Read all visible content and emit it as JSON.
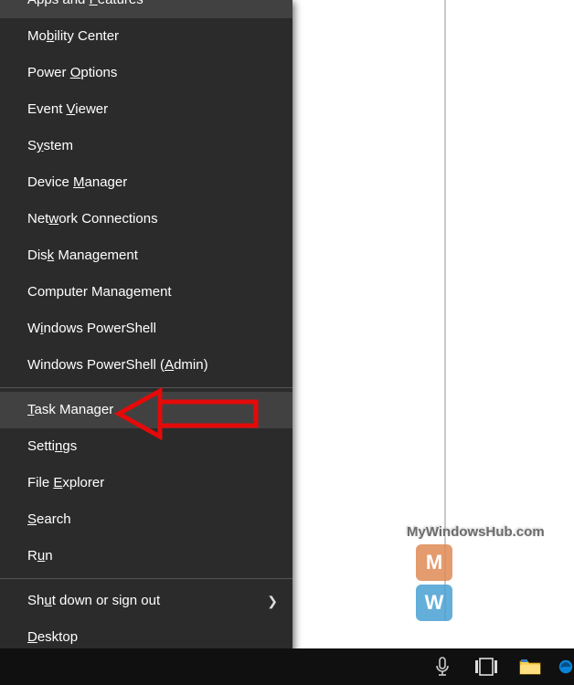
{
  "menu": {
    "items": [
      {
        "label": "Apps and Features",
        "accel_index": 9,
        "highlight": false
      },
      {
        "label": "Mobility Center",
        "accel_index": 2,
        "highlight": false
      },
      {
        "label": "Power Options",
        "accel_index": 6,
        "highlight": false
      },
      {
        "label": "Event Viewer",
        "accel_index": 6,
        "highlight": false
      },
      {
        "label": "System",
        "accel_index": 1,
        "highlight": false
      },
      {
        "label": "Device Manager",
        "accel_index": 7,
        "highlight": false
      },
      {
        "label": "Network Connections",
        "accel_index": 3,
        "highlight": false
      },
      {
        "label": "Disk Management",
        "accel_index": 3,
        "highlight": false
      },
      {
        "label": "Computer Management",
        "accel_index": null,
        "highlight": false
      },
      {
        "label": "Windows PowerShell",
        "accel_index": 1,
        "highlight": false
      },
      {
        "label": "Windows PowerShell (Admin)",
        "accel_index": 20,
        "highlight": false
      },
      {
        "sep": true
      },
      {
        "label": "Task Manager",
        "accel_index": 0,
        "highlight": true
      },
      {
        "label": "Settings",
        "accel_index": 5,
        "highlight": false
      },
      {
        "label": "File Explorer",
        "accel_index": 5,
        "highlight": false
      },
      {
        "label": "Search",
        "accel_index": 0,
        "highlight": false
      },
      {
        "label": "Run",
        "accel_index": 1,
        "highlight": false
      },
      {
        "sep": true
      },
      {
        "label": "Shut down or sign out",
        "accel_index": 2,
        "highlight": false,
        "submenu": true
      },
      {
        "label": "Desktop",
        "accel_index": 0,
        "highlight": false
      }
    ]
  },
  "watermark": {
    "text": "MyWindowsHub.com",
    "tile_m": "M",
    "tile_w": "W"
  },
  "taskbar": {
    "cortana_icon": "mic-icon",
    "taskview_icon": "task-view-icon",
    "explorer_icon": "file-explorer-icon",
    "edge_icon": "edge-icon"
  }
}
